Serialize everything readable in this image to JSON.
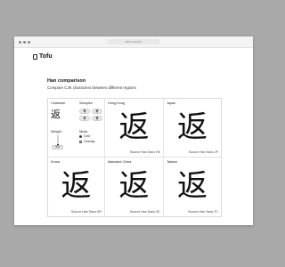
{
  "browser": {
    "url": "tofu.so/cjk"
  },
  "app": {
    "name": "Tofu"
  },
  "page": {
    "title": "Han comparison",
    "subtitle": "Compare CJK characters between different regions"
  },
  "controls": {
    "character_label": "Character",
    "character_value": "返",
    "samples_label": "Samples",
    "samples": [
      "骨",
      "骨",
      "骨",
      "骨"
    ],
    "weight_label": "Weight",
    "weight_value": "400",
    "weight_level": 0.4,
    "mode_label": "Mode",
    "mode_options": [
      "Grid",
      "Overlay"
    ],
    "mode_selected": "Grid"
  },
  "panels": [
    {
      "region": "Hong Kong",
      "glyph": "返",
      "font": "Source Han Sans HK"
    },
    {
      "region": "Japan",
      "glyph": "返",
      "font": "Source Han Sans JP"
    },
    {
      "region": "Korea",
      "glyph": "返",
      "font": "Source Han Sans KR"
    },
    {
      "region": "Mainland China",
      "glyph": "返",
      "font": "Source Han Sans SC"
    },
    {
      "region": "Taiwan",
      "glyph": "返",
      "font": "Source Han Sans TC"
    }
  ],
  "colors": {
    "background": "#a9a9a9",
    "window": "#ffffff",
    "text": "#111111",
    "accent": "#222222"
  }
}
